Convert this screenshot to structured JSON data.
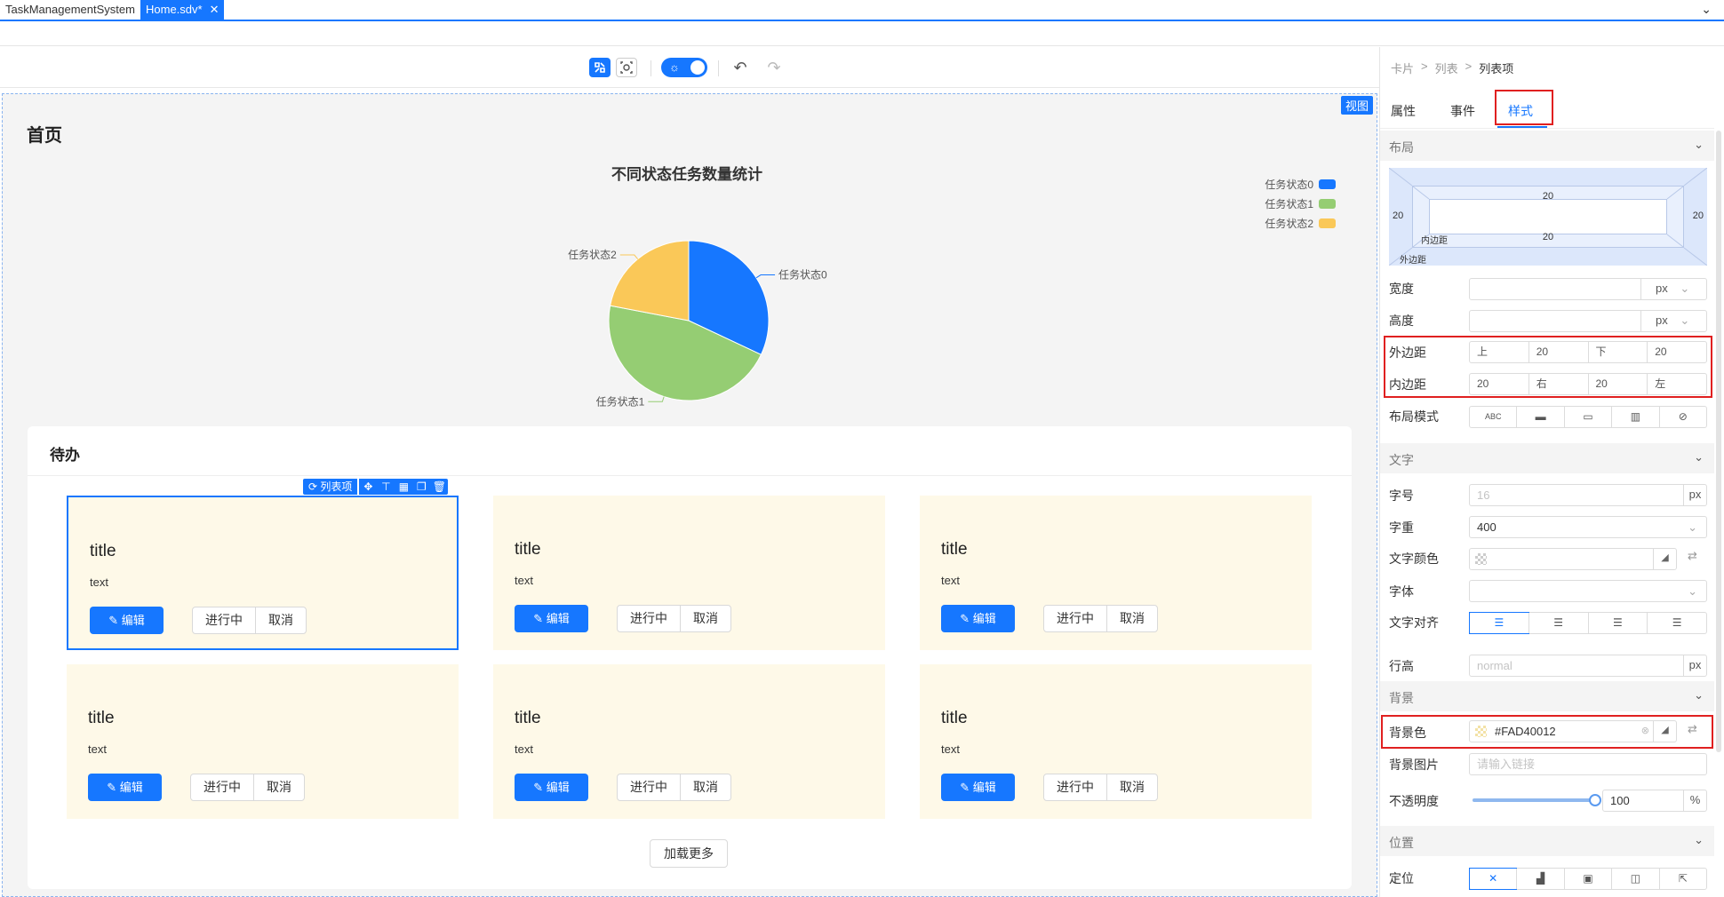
{
  "tabs": [
    {
      "label": "TaskManagementSystem"
    },
    {
      "label": "Home.sdv*"
    }
  ],
  "toolbar": {
    "view_badge": "视图"
  },
  "page": {
    "title": "首页"
  },
  "chart_data": {
    "type": "pie",
    "title": "不同状态任务数量统计",
    "categories": [
      "任务状态0",
      "任务状态1",
      "任务状态2"
    ],
    "values": [
      32,
      46,
      22
    ],
    "colors": [
      "#1677ff",
      "#95cd73",
      "#fac858"
    ],
    "legend_position": "top-right"
  },
  "todo": {
    "title": "待办",
    "toolbar_label": "列表项",
    "load_more": "加载更多",
    "items": [
      {
        "title": "title",
        "text": "text",
        "edit": "编辑",
        "progress": "进行中",
        "cancel": "取消"
      },
      {
        "title": "title",
        "text": "text",
        "edit": "编辑",
        "progress": "进行中",
        "cancel": "取消"
      },
      {
        "title": "title",
        "text": "text",
        "edit": "编辑",
        "progress": "进行中",
        "cancel": "取消"
      },
      {
        "title": "title",
        "text": "text",
        "edit": "编辑",
        "progress": "进行中",
        "cancel": "取消"
      },
      {
        "title": "title",
        "text": "text",
        "edit": "编辑",
        "progress": "进行中",
        "cancel": "取消"
      },
      {
        "title": "title",
        "text": "text",
        "edit": "编辑",
        "progress": "进行中",
        "cancel": "取消"
      }
    ]
  },
  "panel": {
    "breadcrumb": [
      "卡片",
      ">",
      "列表",
      ">",
      "列表项"
    ],
    "tabs": [
      "属性",
      "事件",
      "样式"
    ],
    "layout": {
      "section": "布局",
      "box": {
        "margin_label": "外边距",
        "padding_label": "内边距",
        "top": "20",
        "left": "20",
        "right": "20",
        "inner": "20"
      },
      "width_label": "宽度",
      "height_label": "高度",
      "unit": "px",
      "margin_label": "外边距",
      "padding_label": "内边距",
      "margin": {
        "top_ph": "上",
        "top": "20",
        "bottom_ph": "下",
        "bottom": "20"
      },
      "padding": {
        "top": "20",
        "right_ph": "右",
        "bottom": "20",
        "left_ph": "左"
      },
      "mode_label": "布局模式",
      "mode_abc": "ABC"
    },
    "text": {
      "section": "文字",
      "size_label": "字号",
      "size_ph": "16",
      "size_unit": "px",
      "weight_label": "字重",
      "weight": "400",
      "color_label": "文字颜色",
      "font_label": "字体",
      "align_label": "文字对齐",
      "lineheight_label": "行高",
      "lineheight_ph": "normal",
      "lineheight_unit": "px"
    },
    "background": {
      "section": "背景",
      "color_label": "背景色",
      "color": "#FAD40012",
      "image_label": "背景图片",
      "image_ph": "请输入链接",
      "opacity_label": "不透明度",
      "opacity": "100",
      "opacity_unit": "%",
      "opacity_value": 1.0
    },
    "position": {
      "section": "位置",
      "label": "定位"
    }
  }
}
